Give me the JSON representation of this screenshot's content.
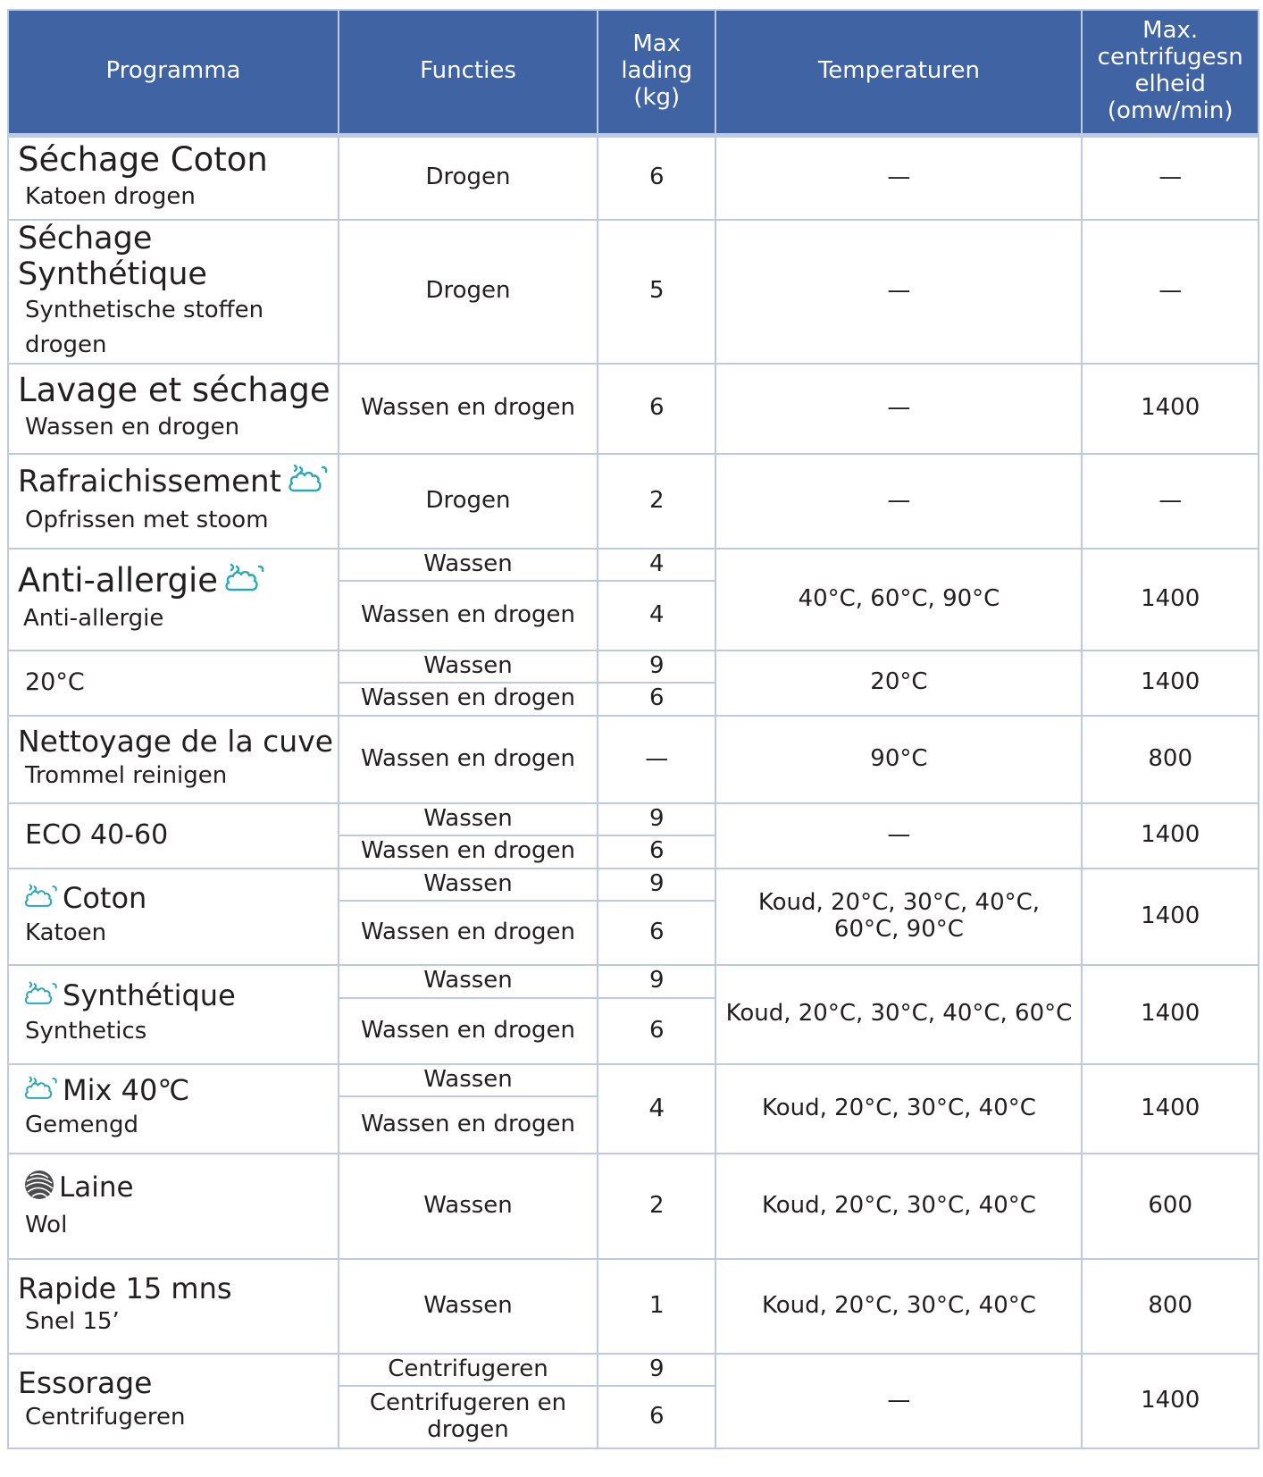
{
  "headers": {
    "program": "Programma",
    "functions": "Functies",
    "max_load": "Max lading (kg)",
    "temperatures": "Temperaturen",
    "max_spin": "Max. centrifugesn elheid (omw/min)"
  },
  "rows": [
    {
      "name": "Séchage Coton",
      "sub": "Katoen drogen",
      "functions": [
        "Drogen"
      ],
      "loads": [
        "6"
      ],
      "temp": "—",
      "spin": "—"
    },
    {
      "name": "Séchage Synthétique",
      "sub": "Synthetische stoffen drogen",
      "functions": [
        "Drogen"
      ],
      "loads": [
        "5"
      ],
      "temp": "—",
      "spin": "—"
    },
    {
      "name": "Lavage et séchage",
      "sub": "Wassen en drogen",
      "functions": [
        "Wassen en drogen"
      ],
      "loads": [
        "6"
      ],
      "temp": "—",
      "spin": "1400"
    },
    {
      "name": "Rafraichissement",
      "sub": "Opfrissen met stoom",
      "icon": "steam-icon",
      "functions": [
        "Drogen"
      ],
      "loads": [
        "2"
      ],
      "temp": "—",
      "spin": "—"
    },
    {
      "name": "Anti-allergie",
      "sub": "Anti-allergie",
      "icon": "steam-icon",
      "functions": [
        "Wassen",
        "Wassen en drogen"
      ],
      "loads": [
        "4",
        "4"
      ],
      "temp": "40°C, 60°C, 90°C",
      "spin": "1400"
    },
    {
      "name": "20°C",
      "sub": "",
      "functions": [
        "Wassen",
        "Wassen en drogen"
      ],
      "loads": [
        "9",
        "6"
      ],
      "temp": "20°C",
      "spin": "1400"
    },
    {
      "name": "Nettoyage de la cuve",
      "sub": "Trommel reinigen",
      "functions": [
        "Wassen en drogen"
      ],
      "loads": [
        "—"
      ],
      "temp": "90°C",
      "spin": "800"
    },
    {
      "name": "ECO 40-60",
      "sub": "",
      "functions": [
        "Wassen",
        "Wassen en drogen"
      ],
      "loads": [
        "9",
        "6"
      ],
      "temp": "—",
      "spin": "1400"
    },
    {
      "name": "Coton",
      "sub": "Katoen",
      "icon": "steam-icon",
      "functions": [
        "Wassen",
        "Wassen en drogen"
      ],
      "loads": [
        "9",
        "6"
      ],
      "temp": "Koud, 20°C, 30°C, 40°C, 60°C, 90°C",
      "spin": "1400"
    },
    {
      "name": "Synthétique",
      "sub": "Synthetics",
      "icon": "steam-icon",
      "functions": [
        "Wassen",
        "Wassen en drogen"
      ],
      "loads": [
        "9",
        "6"
      ],
      "temp": "Koud, 20°C, 30°C, 40°C, 60°C",
      "spin": "1400"
    },
    {
      "name": "Mix 40℃",
      "sub": "Gemengd",
      "icon": "steam-icon",
      "functions": [
        "Wassen",
        "Wassen en drogen"
      ],
      "loads": [
        "4"
      ],
      "temp": "Koud, 20°C, 30°C, 40°C",
      "spin": "1400"
    },
    {
      "name": "Laine",
      "sub": "Wol",
      "icon": "wool-icon",
      "functions": [
        "Wassen"
      ],
      "loads": [
        "2"
      ],
      "temp": "Koud, 20°C, 30°C, 40°C",
      "spin": "600"
    },
    {
      "name": "Rapide 15 mns",
      "sub": "Snel 15’",
      "functions": [
        "Wassen"
      ],
      "loads": [
        "1"
      ],
      "temp": "Koud, 20°C, 30°C, 40°C",
      "spin": "800"
    },
    {
      "name": "Essorage",
      "sub": "Centrifugeren",
      "functions": [
        "Centrifugeren",
        "Centrifugeren en drogen"
      ],
      "loads": [
        "9",
        "6"
      ],
      "temp": "—",
      "spin": "1400"
    }
  ]
}
